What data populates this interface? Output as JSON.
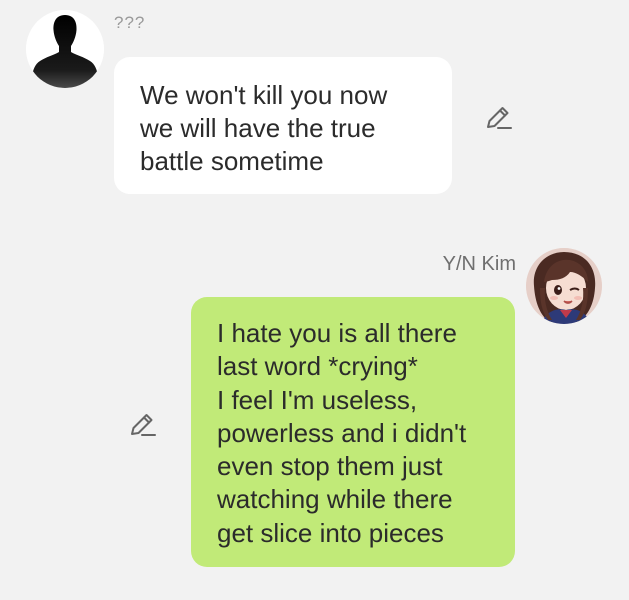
{
  "messages": [
    {
      "sender": "???",
      "side": "left",
      "avatar_icon": "silhouette-avatar-icon",
      "bubble_color": "#ffffff",
      "lines": [
        "We won't kill you now",
        "we will have the true",
        "battle sometime"
      ]
    },
    {
      "sender": "Y/N Kim",
      "side": "right",
      "avatar_icon": "anime-girl-avatar-icon",
      "bubble_color": "#c1ea78",
      "lines": [
        "I hate you is all there",
        "last word *crying*",
        "I feel I'm useless,",
        "powerless and i didn't",
        "even stop them just",
        "watching while there",
        "get slice into pieces"
      ]
    }
  ],
  "colors": {
    "background": "#f2f2f2",
    "sender_text": "#9a9a9a",
    "message_text": "#2b2b2b",
    "edit_icon": "#666666"
  },
  "icons": {
    "edit": "pencil-edit-icon"
  }
}
